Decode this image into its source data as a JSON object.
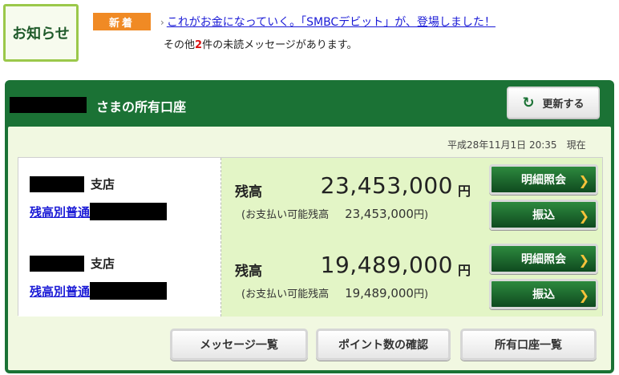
{
  "notice": {
    "box_label": "お知らせ",
    "new_badge": "新着",
    "link_text": "これがお金になっていく。「SMBCデビット」が、登場しました！",
    "unread_prefix": "その他",
    "unread_count": "2",
    "unread_suffix": "件の未読メッセージがあります。"
  },
  "panel": {
    "title": "さまの所有口座",
    "refresh_label": "更新する",
    "timestamp": "平成28年11月1日 20:35　現在"
  },
  "accounts": [
    {
      "branch_suffix": "支店",
      "account_link": "残高別普通",
      "balance_label": "残高",
      "balance": "23,453,000",
      "unit": "円",
      "available_label": "(お支払い可能残高",
      "available_amount": "23,453,000",
      "available_unit": "円)",
      "detail_button": "明細照会",
      "transfer_button": "振込"
    },
    {
      "branch_suffix": "支店",
      "account_link": "残高別普通",
      "balance_label": "残高",
      "balance": "19,489,000",
      "unit": "円",
      "available_label": "(お支払い可能残高",
      "available_amount": "19,489,000",
      "available_unit": "円)",
      "detail_button": "明細照会",
      "transfer_button": "振込"
    }
  ],
  "footer_buttons": {
    "messages": "メッセージ一覧",
    "points": "ポイント数の確認",
    "accounts": "所有口座一覧"
  },
  "colors": {
    "brand_green": "#1b7235",
    "badge_orange": "#f08a24",
    "link_blue": "#1a1ad6",
    "balance_bg": "#e3f5c6"
  },
  "icons": {
    "refresh": "refresh-icon",
    "link_arrow": "chevron-right-icon",
    "button_chevron": "chevron-right-icon"
  }
}
